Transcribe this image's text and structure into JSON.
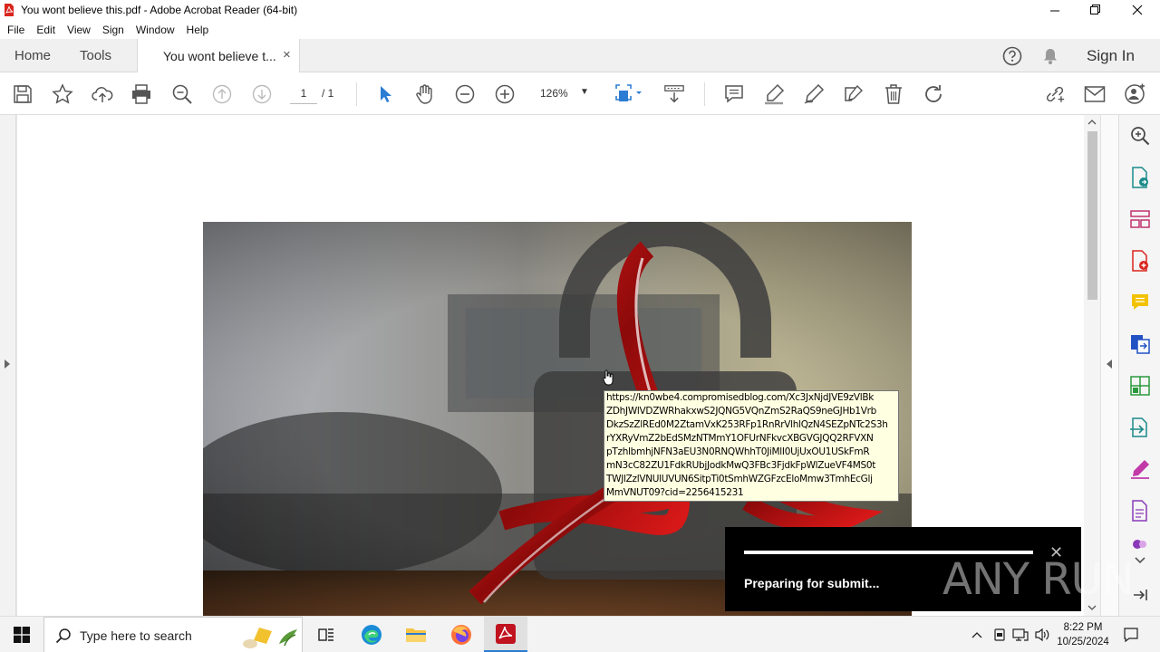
{
  "window": {
    "title": "You wont believe this.pdf - Adobe Acrobat Reader (64-bit)"
  },
  "menu": [
    "File",
    "Edit",
    "View",
    "Sign",
    "Window",
    "Help"
  ],
  "tabs": {
    "home": "Home",
    "tools": "Tools",
    "document": "You wont believe t...",
    "close": "×",
    "sign_in": "Sign In"
  },
  "toolbar": {
    "page_current": "1",
    "page_total": "/  1",
    "zoom": "126%"
  },
  "tooltip": {
    "lines": [
      "https://kn0wbe4.compromisedblog.com/Xc3JxNjdJVE9zVlBk",
      "ZDhJWlVDZWRhakxwS2JQNG5VQnZmS2RaQS9neGJHb1Vrb",
      "DkzSzZlREd0M2ZtamVxK253RFp1RnRrVlhlQzN4SEZpNTc2S3h",
      "rYXRyVmZ2bEdSMzNTMmY1OFUrNFkvcXBGVGJQQ2RFVXN",
      "pTzhlbmhjNFN3aEU3N0RNQWhhT0JiMlI0UjUxOU1USkFmR",
      "mN3cC82ZU1FdkRUbjJodkMwQ3FBc3FjdkFpWlZueVF4MS0t",
      "TWJlZzlVNUlUVUN6SitpTi0tSmhWZGFzcEloMmw3TmhEcGlj",
      "MmVNUT09?cid=2256415231"
    ]
  },
  "notification": {
    "text": "Preparing for submit...",
    "close": "✕",
    "progress": 1.0
  },
  "watermark": "ANY RUN",
  "taskbar": {
    "search_placeholder": "Type here to search",
    "time": "8:22 PM",
    "date": "10/25/2024"
  },
  "colors": {
    "acrobat_red": "#c1121f",
    "accent_blue": "#2b7cd3",
    "tooltip_bg": "#ffffe1"
  }
}
